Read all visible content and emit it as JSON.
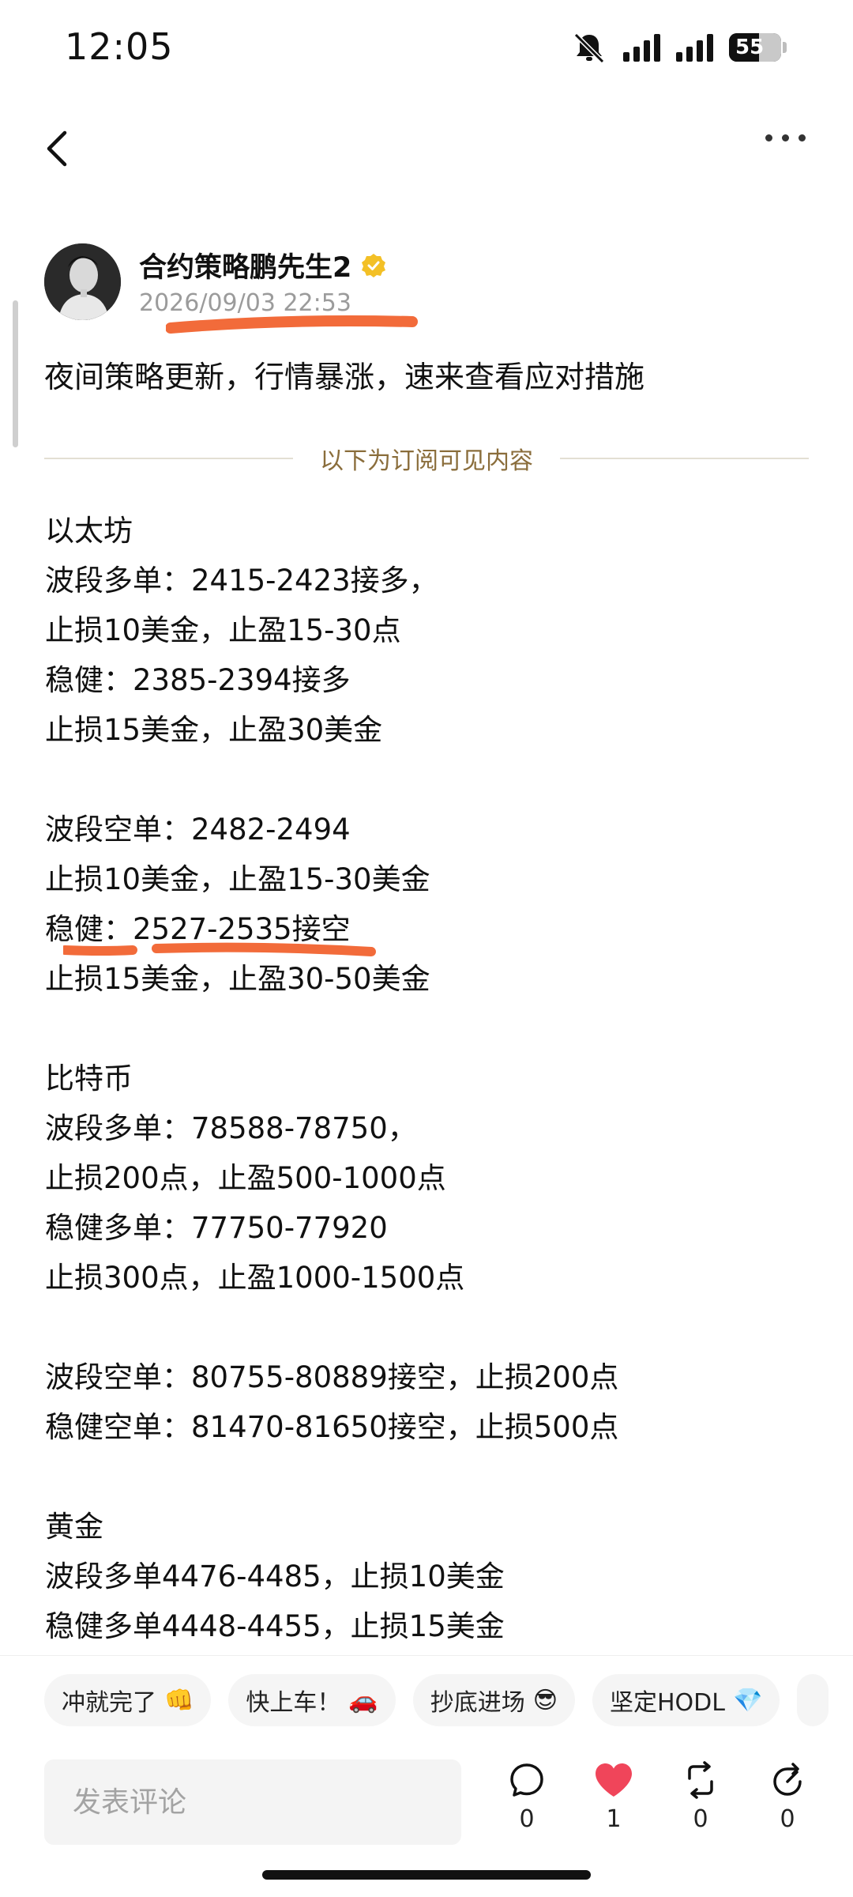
{
  "status_bar": {
    "time": "12:05",
    "battery_level": "55",
    "icons": [
      "bell-muted-icon",
      "signal-icon",
      "signal-icon",
      "battery-icon"
    ]
  },
  "nav": {
    "back_icon": "chevron-left-icon",
    "more_icon": "more-dots-icon"
  },
  "post": {
    "author": "合约策略鹏先生2",
    "verified_icon": "verified-badge-icon",
    "time": "2026/09/03 22:53",
    "title": "夜间策略更新，行情暴涨，速来查看应对措施",
    "divider_text": "以下为订阅可见内容",
    "lines": [
      "以太坊",
      "波段多单：2415-2423接多，",
      "止损10美金，止盈15-30点",
      "稳健：2385-2394接多",
      "止损15美金，止盈30美金",
      "",
      "波段空单：2482-2494",
      "止损10美金，止盈15-30美金",
      "稳健：2527-2535接空",
      "止损15美金，止盈30-50美金",
      "",
      "比特币",
      "波段多单：78588-78750，",
      "止损200点，止盈500-1000点",
      "稳健多单：77750-77920",
      "止损300点，止盈1000-1500点",
      "",
      "波段空单：80755-80889接空，止损200点",
      "稳健空单：81470-81650接空，止损500点",
      "",
      "黄金",
      "波段多单4476-4485，止损10美金",
      "稳健多单4448-4455，止损15美金"
    ]
  },
  "reactions": [
    {
      "label": "冲就完了",
      "emoji": "👊"
    },
    {
      "label": "快上车！",
      "emoji": "🚗"
    },
    {
      "label": "抄底进场",
      "emoji": "😎"
    },
    {
      "label": "坚定HODL",
      "emoji": "💎"
    }
  ],
  "bottom_bar": {
    "comment_placeholder": "发表评论",
    "comment_count": "0",
    "like_count": "1",
    "repost_count": "0",
    "share_count": "0"
  },
  "colors": {
    "annotation": "#f26b3a",
    "like": "#f0455a",
    "divider_text": "#8a6d3b"
  }
}
